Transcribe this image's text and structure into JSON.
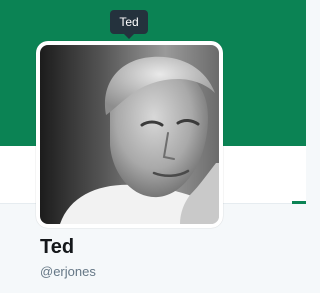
{
  "profile": {
    "tooltip": "Ted",
    "name": "Ted",
    "handle": "@erjones"
  },
  "colors": {
    "banner": "#0b8354",
    "name": "#14171a",
    "handle": "#657786",
    "tooltip_bg": "#24323d"
  },
  "icons": {
    "avatar": "profile-photo"
  }
}
